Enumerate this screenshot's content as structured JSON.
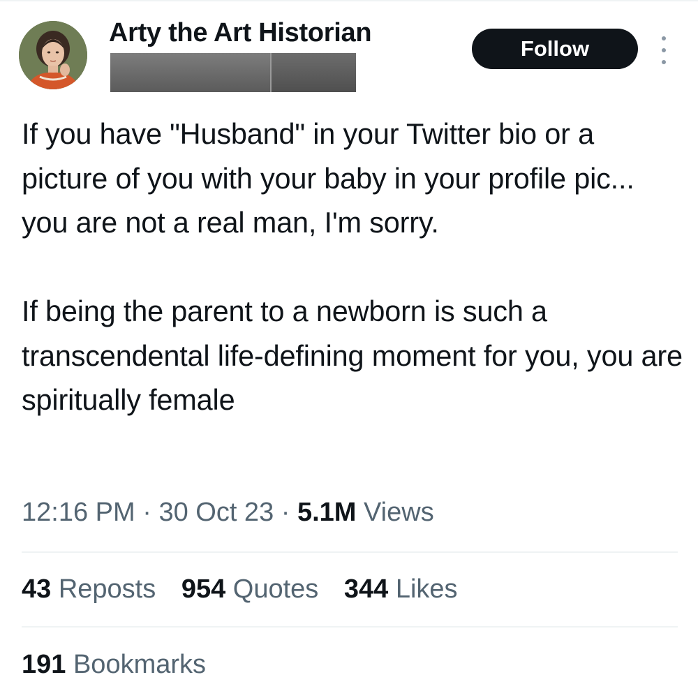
{
  "author": {
    "display_name": "Arty the Art Historian",
    "avatar_icon": "portrait-avatar",
    "handle_redacted": true
  },
  "actions": {
    "follow_label": "Follow",
    "more_icon": "vertical-ellipsis-icon"
  },
  "tweet": {
    "paragraphs": [
      "If you have \"Husband\" in your Twitter bio or a picture of you with your baby in your profile pic... you are not a real man, I'm sorry.",
      "If being the parent to a newborn is such a transcendental life-defining moment for you, you are spiritually female"
    ]
  },
  "meta": {
    "time": "12:16 PM",
    "sep1": " · ",
    "date": "30 Oct 23",
    "sep2": " · ",
    "views_count": "5.1M",
    "views_label": " Views"
  },
  "stats": [
    {
      "count": "43",
      "label": " Reposts"
    },
    {
      "count": "954",
      "label": " Quotes"
    },
    {
      "count": "344",
      "label": " Likes"
    }
  ],
  "bookmarks": {
    "count": "191",
    "label": " Bookmarks"
  },
  "colors": {
    "text_primary": "#0f1419",
    "text_secondary": "#536471",
    "divider": "#eff3f4",
    "follow_bg": "#0f1419",
    "follow_text": "#ffffff"
  }
}
